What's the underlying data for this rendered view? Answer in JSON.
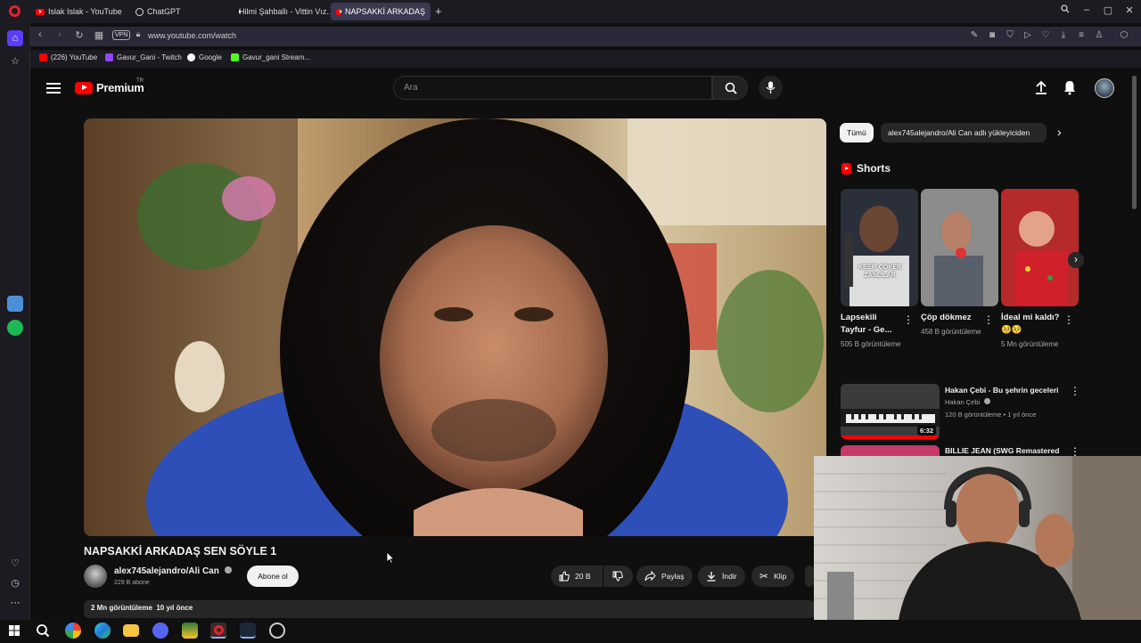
{
  "browser": {
    "tabs": [
      {
        "label": "Islak Islak - YouTube",
        "icon": "youtube-icon"
      },
      {
        "label": "ChatGPT",
        "icon": "chatgpt-icon"
      },
      {
        "label": "Hilmi Şahballı - Vittin Vız...",
        "icon": "youtube-icon"
      },
      {
        "label": "NAPSAKKİ ARKADAŞ",
        "icon": "youtube-icon"
      }
    ],
    "url": "www.youtube.com/watch",
    "vpn_label": "VPN",
    "bookmarks": [
      {
        "label": "(226) YouTube",
        "color": "#ff0000"
      },
      {
        "label": "Gavur_Gani - Twitch",
        "color": "#9146ff"
      },
      {
        "label": "Google",
        "color": "#4285f4"
      },
      {
        "label": "Gavur_gani Stream...",
        "color": "#53fc18"
      }
    ]
  },
  "header": {
    "logo_text": "Premium",
    "logo_country": "TR",
    "search_placeholder": "Ara"
  },
  "video": {
    "title": "NAPSAKKİ ARKADAŞ SEN SÖYLE 1",
    "channel": "alex745alejandro/Ali Can",
    "subscribers": "229 B abone",
    "subscribe_label": "Abone ol",
    "likes": "20 B",
    "share_label": "Paylaş",
    "download_label": "İndir",
    "clip_label": "Klip",
    "description_meta": "2 Mn görüntüleme  10 yıl önce"
  },
  "sidebar_right": {
    "chips": [
      "Tümü",
      "alex745alejandro/Ali Can adlı yükleyiciden"
    ],
    "shorts_heading": "Shorts",
    "shorts": [
      {
        "title": "Lapsekili Tayfur - Ge...",
        "views": "505 B görüntüleme",
        "overlay": "KESİP ÇÖKER ZANLILAR"
      },
      {
        "title": "Çöp dökmez",
        "views": "458 B görüntüleme",
        "overlay": ""
      },
      {
        "title": "İdeal mi kaldı? 🥺🥺",
        "views": "5 Mn görüntüleme",
        "overlay": ""
      }
    ],
    "recommendations": [
      {
        "title": "Hakan Çebi - Bu şehrin geceleri",
        "channel": "Hakan Çebi",
        "meta": "120 B görüntüleme • 1 yıl önce",
        "duration": "6:32"
      },
      {
        "title": "BILLIE JEAN (SWG Remastered",
        "channel": "",
        "meta": "",
        "duration": ""
      }
    ]
  },
  "colors": {
    "accent": "#ff0000",
    "background": "#0f0f0f",
    "surface": "#272727"
  }
}
